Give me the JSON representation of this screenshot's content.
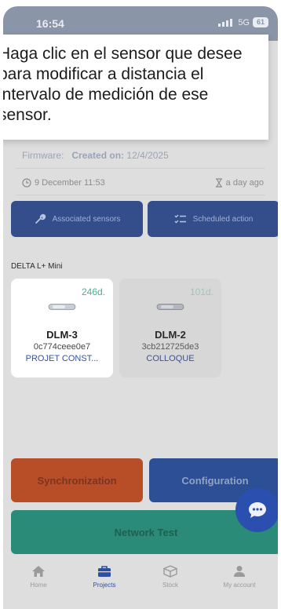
{
  "status_bar": {
    "time": "16:54",
    "network": "5G",
    "battery": "61"
  },
  "tooltip": {
    "text": "Haga clic en el sensor que desee para modificar a distancia el intervalo de medición de ese sensor."
  },
  "device_info": {
    "firmware_label": "Firmware:",
    "created_label": "Created on:",
    "created_value": "12/4/2025",
    "date": "9 December 11:53",
    "ago": "a day ago"
  },
  "actions": {
    "associated_sensors": "Associated sensors",
    "scheduled_action": "Scheduled action"
  },
  "sensor_group": {
    "label": "DELTA L+ Mini"
  },
  "sensors": [
    {
      "days": "246d.",
      "name": "DLM-3",
      "id": "0c774ceee0e7",
      "project": "PROJET CONST...",
      "selected": true
    },
    {
      "days": "101d.",
      "name": "DLM-2",
      "id": "3cb212725de3",
      "project": "COLLOQUE",
      "selected": false
    }
  ],
  "buttons": {
    "synchronization": "Synchronization",
    "configuration": "Configuration",
    "network_test": "Network Test"
  },
  "nav": [
    {
      "label": "Home",
      "icon": "home-icon"
    },
    {
      "label": "Projects",
      "icon": "briefcase-icon"
    },
    {
      "label": "Stock",
      "icon": "box-icon"
    },
    {
      "label": "My account",
      "icon": "user-icon"
    }
  ],
  "colors": {
    "primary": "#2c4fa4",
    "accent_green": "#46b08f",
    "sync_orange": "#b84e27",
    "network_teal": "#2a8c78"
  }
}
